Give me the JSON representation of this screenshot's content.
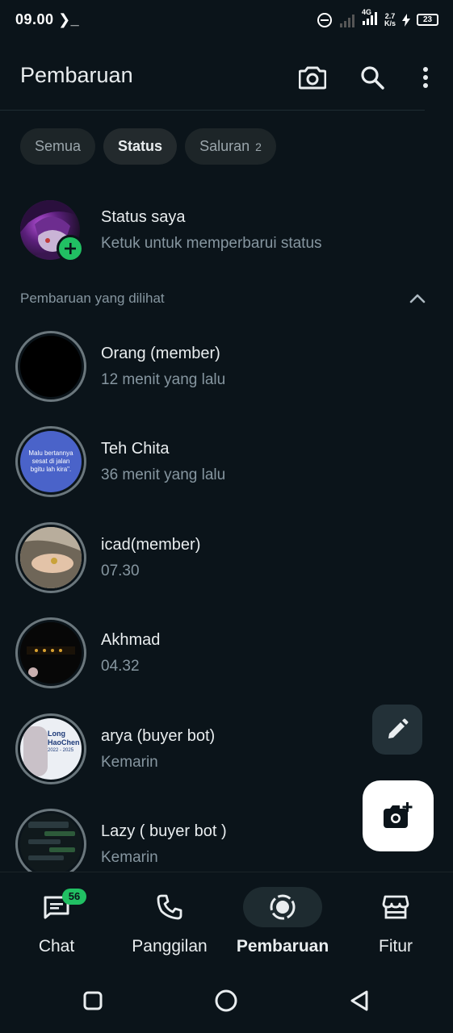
{
  "status_bar": {
    "time": "09.00",
    "network": "4G",
    "speed_value": "2.7",
    "speed_unit": "K/s",
    "battery": "23"
  },
  "header": {
    "title": "Pembaruan",
    "camera_icon": "camera-icon",
    "search_icon": "search-icon",
    "menu_icon": "more-vert-icon"
  },
  "filters": [
    {
      "label": "Semua",
      "active": false
    },
    {
      "label": "Status",
      "active": true
    },
    {
      "label": "Saluran",
      "count": "2",
      "active": false
    }
  ],
  "my_status": {
    "title": "Status saya",
    "subtitle": "Ketuk untuk memperbarui status"
  },
  "viewed_section": {
    "label": "Pembaruan yang dilihat"
  },
  "statuses": [
    {
      "name": "Orang (member)",
      "time": "12 menit yang lalu"
    },
    {
      "name": "Teh Chita",
      "time": "36 menit yang lalu",
      "thumb_text": "Malu bertannya sesat di jalan bgitu lah kira\"."
    },
    {
      "name": "icad(member)",
      "time": "07.30"
    },
    {
      "name": "Akhmad",
      "time": "04.32"
    },
    {
      "name": "arya (buyer bot)",
      "time": "Kemarin",
      "thumb_text_1": "Long",
      "thumb_text_2": "HaoChen",
      "thumb_text_3": "2022 - 2025"
    },
    {
      "name": "Lazy ( buyer bot )",
      "time": "Kemarin"
    }
  ],
  "bottom_nav": [
    {
      "label": "Chat",
      "badge": "56",
      "icon": "chat-icon"
    },
    {
      "label": "Panggilan",
      "icon": "phone-icon"
    },
    {
      "label": "Pembaruan",
      "icon": "updates-icon",
      "active": true
    },
    {
      "label": "Fitur",
      "icon": "store-icon"
    }
  ],
  "colors": {
    "background": "#0b141a",
    "accent": "#21c063",
    "text_primary": "#e9edef",
    "text_secondary": "#8696a0"
  }
}
